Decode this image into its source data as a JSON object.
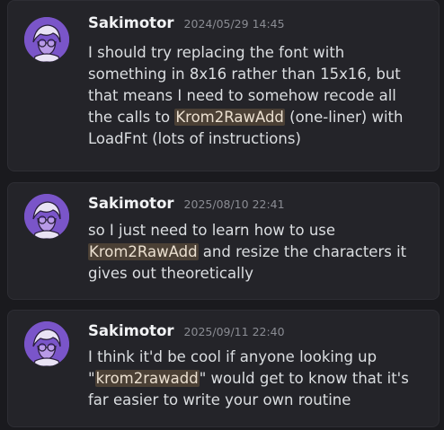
{
  "messages": [
    {
      "author": "Sakimotor",
      "timestamp": "2024/05/29 14:45",
      "lines": [
        {
          "pre": "I should try replacing the font with",
          "hl": "",
          "post": ""
        },
        {
          "pre": "something in 8x16 rather than 15x16, but",
          "hl": "",
          "post": ""
        },
        {
          "pre": "that means I need to somehow recode all",
          "hl": "",
          "post": ""
        },
        {
          "pre": "the calls to ",
          "hl": "Krom2RawAdd",
          "post": " (one-liner) with"
        },
        {
          "pre": "LoadFnt (lots of instructions)",
          "hl": "",
          "post": ""
        }
      ]
    },
    {
      "author": "Sakimotor",
      "timestamp": "2025/08/10 22:41",
      "lines": [
        {
          "pre": "so I just need to learn how to use",
          "hl": "",
          "post": ""
        },
        {
          "pre": "",
          "hl": "Krom2RawAdd",
          "post": " and resize the characters it"
        },
        {
          "pre": "gives out theoretically",
          "hl": "",
          "post": ""
        }
      ]
    },
    {
      "author": "Sakimotor",
      "timestamp": "2025/09/11 22:40",
      "lines": [
        {
          "pre": "I think it'd be cool if anyone looking up",
          "hl": "",
          "post": ""
        },
        {
          "pre": "\"",
          "hl": "krom2rawadd",
          "post": "\" would get to know that it's"
        },
        {
          "pre": "far easier to write your own routine",
          "hl": "",
          "post": ""
        }
      ]
    }
  ],
  "colors": {
    "background": "#1a1a1e",
    "card": "#242429",
    "highlight": "#4b4035",
    "avatar": "#7a55c9"
  },
  "icons": {
    "avatar": "user-avatar-icon"
  }
}
